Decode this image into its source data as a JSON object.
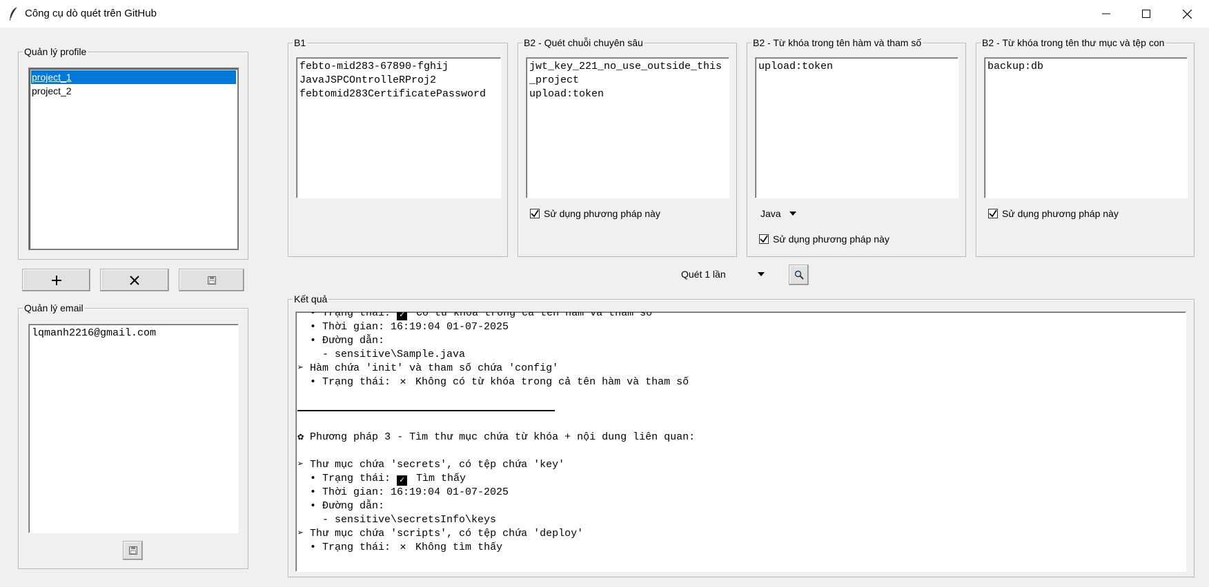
{
  "window": {
    "title": "Công cụ dò quét trên GitHub"
  },
  "profiles": {
    "group_label": "Quản lý profile",
    "items": [
      "project_1",
      "project_2"
    ],
    "selected": "project_1"
  },
  "profile_buttons": {
    "add_icon": "plus-icon",
    "delete_icon": "close-icon",
    "save_icon": "save-icon"
  },
  "emails": {
    "group_label": "Quản lý email",
    "content": "lqmanh2216@gmail.com",
    "save_icon": "save-icon"
  },
  "b1": {
    "group_label": "B1",
    "content": "febto-mid283-67890-fghij\nJavaJSPCOntrolleRProj2\nfebtomid283CertificatePassword"
  },
  "b2_deep": {
    "group_label": "B2 - Quét chuỗi chuyên sâu",
    "content": "jwt_key_221_no_use_outside_this_project\nupload:token",
    "checkbox_label": "Sử dụng phương pháp này",
    "checked": true
  },
  "b2_func": {
    "group_label": "B2 - Từ khóa trong tên hàm và tham số",
    "content": "upload:token",
    "language": "Java",
    "checkbox_label": "Sử dụng phương pháp này",
    "checked": true
  },
  "b2_folder": {
    "group_label": "B2 - Từ khóa trong tên thư mục và tệp con",
    "content": "backup:db",
    "checkbox_label": "Sử dụng phương pháp này",
    "checked": true
  },
  "scan": {
    "mode": "Quét 1 lần",
    "search_icon": "search-icon"
  },
  "results": {
    "group_label": "Kết quả",
    "lines": [
      {
        "indent": "  ",
        "bullet": "•",
        "text": "Trạng thái: ",
        "mark": "check",
        "tail": " Có từ khóa trong cả tên hàm và tham số"
      },
      {
        "indent": "  ",
        "bullet": "•",
        "text": "Thời gian: 16:19:04 01-07-2025",
        "mark": "",
        "tail": ""
      },
      {
        "indent": "  ",
        "bullet": "•",
        "text": "Đường dẫn:",
        "mark": "",
        "tail": ""
      },
      {
        "indent": "    ",
        "bullet": "-",
        "text": "sensitive\\Sample.java",
        "mark": "",
        "tail": ""
      },
      {
        "indent": "",
        "bullet": "➢",
        "text": "Hàm chứa 'init' và tham số chứa 'config'",
        "mark": "",
        "tail": ""
      },
      {
        "indent": "  ",
        "bullet": "•",
        "text": "Trạng thái: ",
        "mark": "cross",
        "tail": " Không có từ khóa trong cả tên hàm và tham số"
      },
      {
        "indent": "",
        "bullet": "",
        "text": "",
        "mark": "",
        "tail": ""
      },
      {
        "indent": "",
        "bullet": "",
        "text": "",
        "mark": "divider",
        "tail": ""
      },
      {
        "indent": "",
        "bullet": "",
        "text": "",
        "mark": "",
        "tail": ""
      },
      {
        "indent": "",
        "bullet": "✿",
        "text": "Phương pháp 3 - Tìm thư mục chứa từ khóa + nội dung liên quan:",
        "mark": "",
        "tail": ""
      },
      {
        "indent": "",
        "bullet": "",
        "text": "",
        "mark": "",
        "tail": ""
      },
      {
        "indent": "",
        "bullet": "➢",
        "text": "Thư mục chứa 'secrets', có tệp chứa 'key'",
        "mark": "",
        "tail": ""
      },
      {
        "indent": "  ",
        "bullet": "•",
        "text": "Trạng thái: ",
        "mark": "check",
        "tail": " Tìm thấy"
      },
      {
        "indent": "  ",
        "bullet": "•",
        "text": "Thời gian: 16:19:04 01-07-2025",
        "mark": "",
        "tail": ""
      },
      {
        "indent": "  ",
        "bullet": "•",
        "text": "Đường dẫn:",
        "mark": "",
        "tail": ""
      },
      {
        "indent": "    ",
        "bullet": "-",
        "text": "sensitive\\secretsInfo\\keys",
        "mark": "",
        "tail": ""
      },
      {
        "indent": "",
        "bullet": "➢",
        "text": "Thư mục chứa 'scripts', có tệp chứa 'deploy'",
        "mark": "",
        "tail": ""
      },
      {
        "indent": "  ",
        "bullet": "•",
        "text": "Trạng thái: ",
        "mark": "cross",
        "tail": " Không tìm thấy"
      }
    ]
  }
}
